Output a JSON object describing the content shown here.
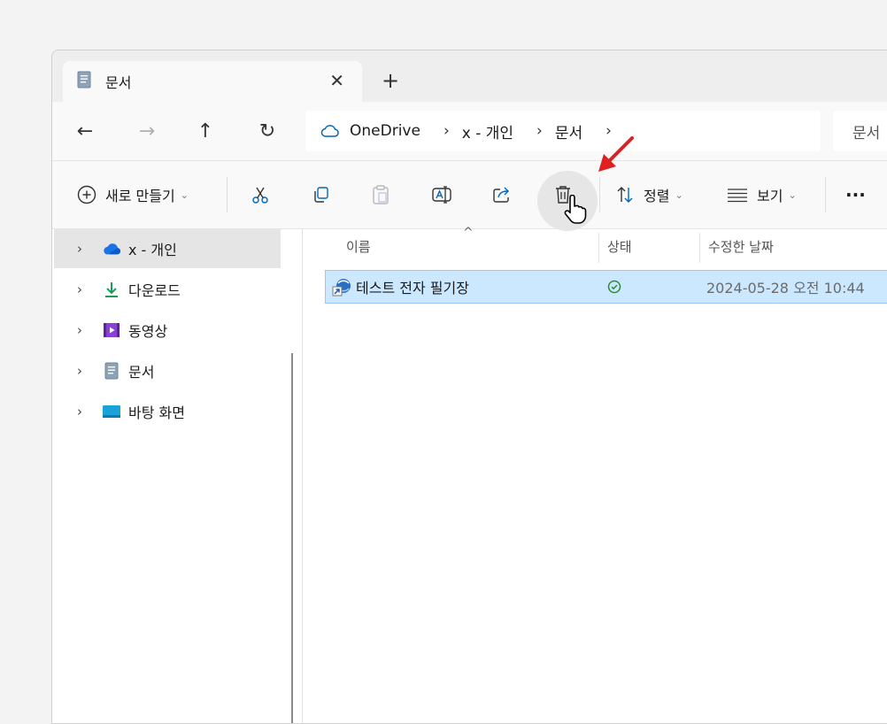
{
  "tab": {
    "title": "문서",
    "close_symbol": "✕",
    "new_tab_symbol": "+"
  },
  "nav": {
    "back": "←",
    "forward": "→",
    "up": "↑",
    "refresh": "↻"
  },
  "address": {
    "crumbs": [
      "OneDrive",
      "x - 개인",
      "문서"
    ],
    "separator": "›"
  },
  "search": {
    "text": "문서"
  },
  "commands": {
    "new_label": "새로 만들기",
    "sort_label": "정렬",
    "view_label": "보기",
    "more": "···",
    "dropdown_chevron": "⌄"
  },
  "sidebar": {
    "items": [
      {
        "label": "x - 개인",
        "icon": "onedrive-cloud-icon"
      },
      {
        "label": "다운로드",
        "icon": "download-icon"
      },
      {
        "label": "동영상",
        "icon": "video-icon"
      },
      {
        "label": "문서",
        "icon": "document-icon"
      },
      {
        "label": "바탕 화면",
        "icon": "desktop-icon"
      }
    ],
    "expander": "›"
  },
  "columns": {
    "name": "이름",
    "status": "상태",
    "modified": "수정한 날짜",
    "sort_caret": "^"
  },
  "files": [
    {
      "name": "테스트 전자 필기장",
      "status": "synced",
      "modified": "2024-05-28 오전 10:44"
    }
  ],
  "colors": {
    "accent": "#0067c0",
    "selection": "#cce8ff",
    "annotation_arrow": "#e02020",
    "synced_green": "#2e8b3a"
  }
}
